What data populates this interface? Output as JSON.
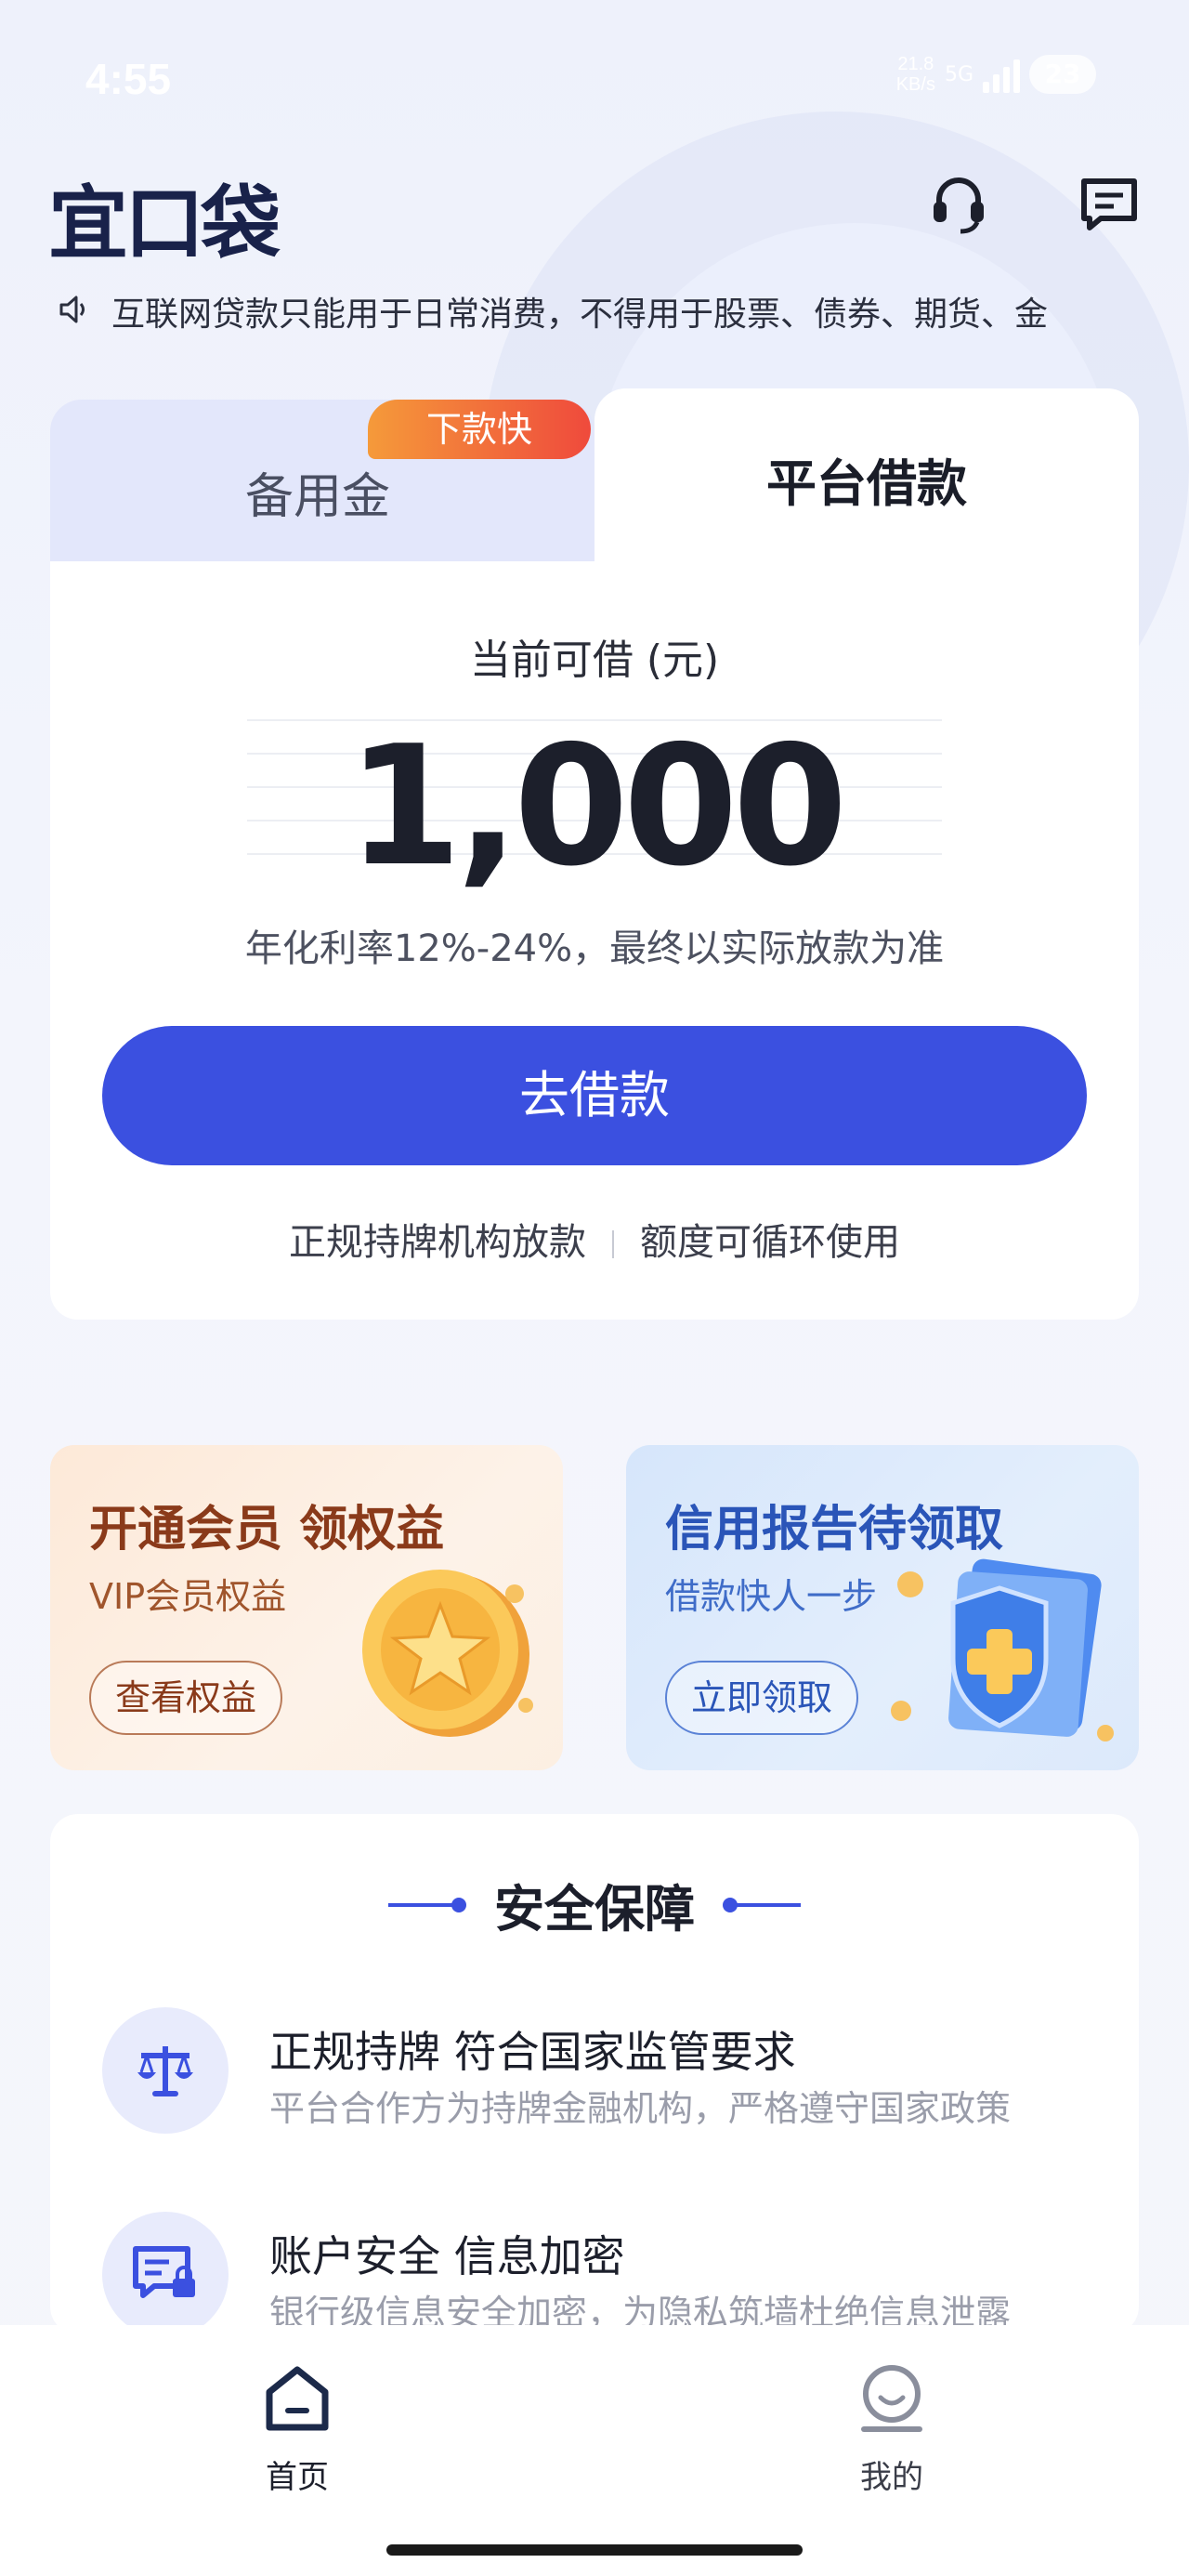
{
  "status": {
    "time": "4:55",
    "net_speed_value": "21.8",
    "net_speed_unit": "KB/s",
    "network": "5G",
    "battery": "23"
  },
  "header": {
    "logo": "宜口袋",
    "support_icon": "headset-icon",
    "message_icon": "message-icon"
  },
  "notice": {
    "icon": "speaker-icon",
    "text": "互联网贷款只能用于日常消费，不得用于股票、债券、期货、金"
  },
  "tabs": {
    "left_label": "备用金",
    "left_badge": "下款快",
    "right_label": "平台借款"
  },
  "loan": {
    "available_label": "当前可借 (元)",
    "amount": "1,000",
    "rate_note": "年化利率12%-24%，最终以实际放款为准",
    "button_label": "去借款",
    "feature_1": "正规持牌机构放款",
    "feature_2": "额度可循环使用"
  },
  "promos": {
    "vip": {
      "title": "开通会员 领权益",
      "subtitle": "VIP会员权益",
      "button": "查看权益"
    },
    "credit": {
      "title": "信用报告待领取",
      "subtitle": "借款快人一步",
      "button": "立即领取"
    }
  },
  "security": {
    "title": "安全保障",
    "items": [
      {
        "icon": "scale-icon",
        "heading": "正规持牌 符合国家监管要求",
        "desc": "平台合作方为持牌金融机构，严格遵守国家政策"
      },
      {
        "icon": "secure-chat-icon",
        "heading": "账户安全 信息加密",
        "desc": "银行级信息安全加密，为隐私筑墙杜绝信息泄露"
      }
    ]
  },
  "tabbar": {
    "home": "首页",
    "mine": "我的"
  },
  "colors": {
    "primary": "#3b50e0",
    "badge_start": "#f59a3a",
    "badge_end": "#ef4a3c"
  }
}
